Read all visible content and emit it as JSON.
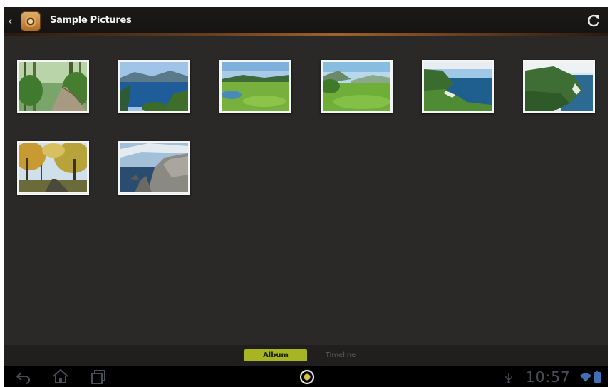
{
  "app": {
    "title": "Sample Pictures"
  },
  "photos": [
    {
      "subject": "forest boardwalk"
    },
    {
      "subject": "mountain lake"
    },
    {
      "subject": "green meadow lake"
    },
    {
      "subject": "green hills"
    },
    {
      "subject": "coastal cliffs"
    },
    {
      "subject": "coastal hills"
    },
    {
      "subject": "autumn forest"
    },
    {
      "subject": "rocky coast"
    }
  ],
  "tabs": {
    "album": "Album",
    "timeline": "Timeline"
  },
  "status": {
    "time": "10:57"
  },
  "colors": {
    "accent": "#a6b521",
    "background": "#2a2928",
    "actionbar": "#171615"
  },
  "icons": [
    "back-icon",
    "app-icon",
    "refresh-icon",
    "nav-back-icon",
    "nav-home-icon",
    "nav-recents-icon",
    "camera-shutter-icon",
    "usb-icon",
    "wifi-icon",
    "battery-icon"
  ]
}
